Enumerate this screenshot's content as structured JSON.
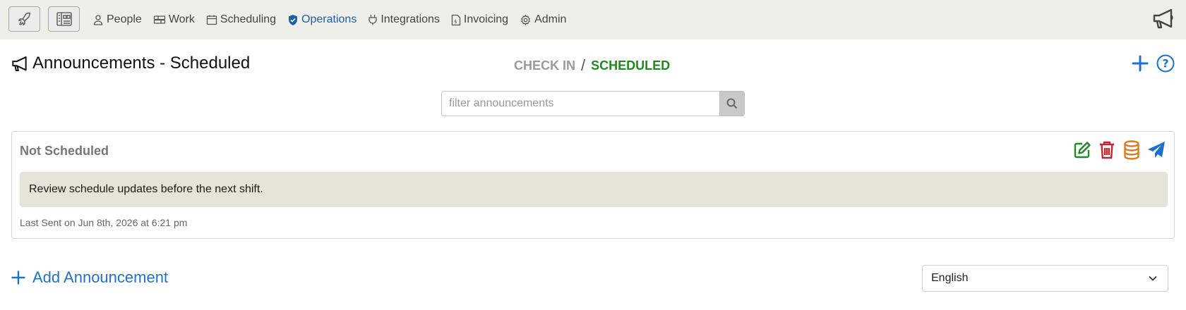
{
  "nav": {
    "items": [
      {
        "label": "People",
        "icon": "person-icon"
      },
      {
        "label": "Work",
        "icon": "work-icon"
      },
      {
        "label": "Scheduling",
        "icon": "calendar-icon"
      },
      {
        "label": "Operations",
        "icon": "shield-check-icon",
        "active": true
      },
      {
        "label": "Integrations",
        "icon": "plug-icon"
      },
      {
        "label": "Invoicing",
        "icon": "invoice-icon"
      },
      {
        "label": "Admin",
        "icon": "gear-icon"
      }
    ],
    "active_color": "#1d5fa6"
  },
  "header": {
    "title": "Announcements - Scheduled",
    "breadcrumb": {
      "first": "CHECK IN",
      "separator": "/",
      "current": "SCHEDULED"
    }
  },
  "filter": {
    "placeholder": "filter announcements",
    "value": ""
  },
  "announcement": {
    "status": "Not Scheduled",
    "message": "Review schedule updates before the next shift.",
    "meta": "Last Sent on Jun 8th, 2026 at 6:21 pm",
    "action_colors": {
      "edit": "#1f8a1f",
      "delete": "#c0262d",
      "archive": "#d77b1e",
      "send": "#1d72cf"
    }
  },
  "footer": {
    "add_label": "Add Announcement",
    "language": "English"
  },
  "colors": {
    "accent": "#1d72cf",
    "nav_bg": "#efefea",
    "message_bg": "#e6e3d9",
    "active_green": "#1f8a1f"
  }
}
